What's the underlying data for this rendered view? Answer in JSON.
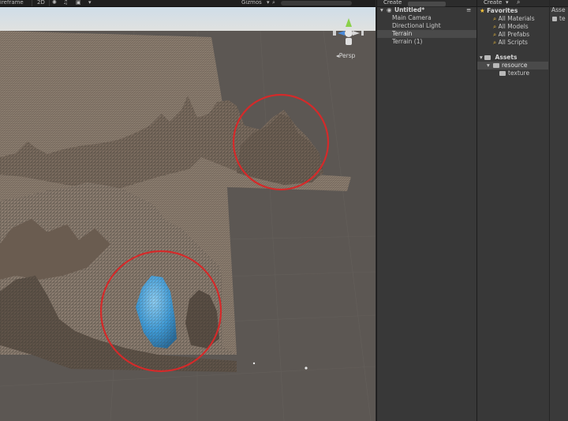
{
  "scene": {
    "toolbar": {
      "shading_mode": "ireframe",
      "mode_2d": "2D",
      "gizmos": "Gizmos"
    },
    "camera_label": "Persp"
  },
  "hierarchy": {
    "create_label": "Create",
    "scene_name": "Untitled*",
    "items": [
      {
        "label": "Main Camera",
        "selected": false
      },
      {
        "label": "Directional Light",
        "selected": false
      },
      {
        "label": "Terrain",
        "selected": true
      },
      {
        "label": "Terrain (1)",
        "selected": false
      }
    ]
  },
  "project": {
    "create_label": "Create",
    "favorites_label": "Favorites",
    "favorites": [
      "All Materials",
      "All Models",
      "All Prefabs",
      "All Scripts"
    ],
    "assets_label": "Assets",
    "assets_children": [
      {
        "label": "resource",
        "selected": true
      },
      {
        "label": "texture",
        "selected": false
      }
    ],
    "right_header": "Asse",
    "right_item": "te"
  },
  "colors": {
    "selection_row": "#4a4a4a",
    "highlight_circle": "#d42a2a",
    "blue_mound": "#4aa6e0",
    "terrain": "#8a7b6c"
  }
}
